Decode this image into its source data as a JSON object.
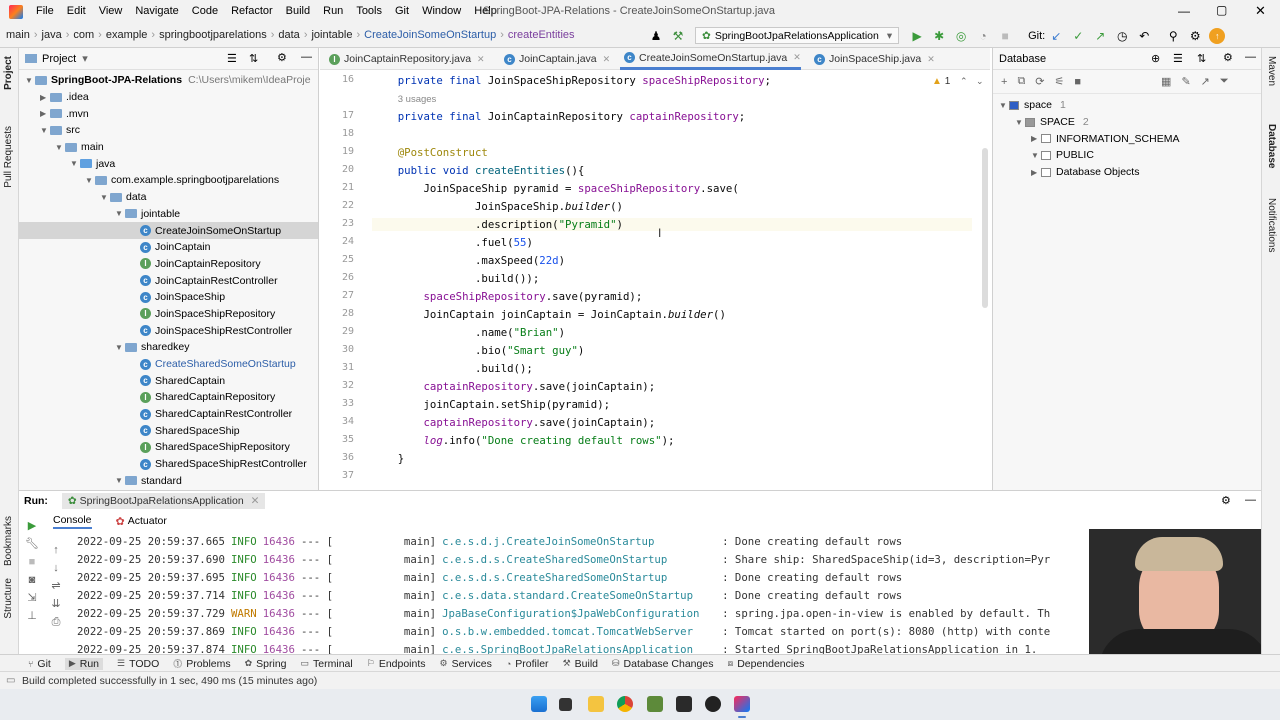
{
  "titlebar": {
    "menus": [
      "File",
      "Edit",
      "View",
      "Navigate",
      "Code",
      "Refactor",
      "Build",
      "Run",
      "Tools",
      "Git",
      "Window",
      "Help"
    ],
    "title": "SpringBoot-JPA-Relations - CreateJoinSomeOnStartup.java"
  },
  "navbar": {
    "crumbs": [
      "main",
      "java",
      "com",
      "example",
      "springbootjparelations",
      "data",
      "jointable",
      "CreateJoinSomeOnStartup",
      "createEntities"
    ],
    "run_config": "SpringBootJpaRelationsApplication",
    "git_label": "Git:"
  },
  "project": {
    "title": "Project",
    "items": [
      {
        "label": "SpringBoot-JPA-Relations",
        "extra": "C:\\Users\\mikem\\IdeaProje",
        "depth": 0,
        "icon": "folder",
        "arrow": "down"
      },
      {
        "label": ".idea",
        "depth": 1,
        "icon": "folder",
        "arrow": "right"
      },
      {
        "label": ".mvn",
        "depth": 1,
        "icon": "folder",
        "arrow": "right"
      },
      {
        "label": "src",
        "depth": 1,
        "icon": "folder",
        "arrow": "down"
      },
      {
        "label": "main",
        "depth": 2,
        "icon": "folder",
        "arrow": "down"
      },
      {
        "label": "java",
        "depth": 3,
        "icon": "folder-src",
        "arrow": "down"
      },
      {
        "label": "com.example.springbootjparelations",
        "depth": 4,
        "icon": "folder",
        "arrow": "down"
      },
      {
        "label": "data",
        "depth": 5,
        "icon": "folder",
        "arrow": "down"
      },
      {
        "label": "jointable",
        "depth": 6,
        "icon": "folder",
        "arrow": "down"
      },
      {
        "label": "CreateJoinSomeOnStartup",
        "depth": 7,
        "icon": "class",
        "selected": true
      },
      {
        "label": "JoinCaptain",
        "depth": 7,
        "icon": "class"
      },
      {
        "label": "JoinCaptainRepository",
        "depth": 7,
        "icon": "interface"
      },
      {
        "label": "JoinCaptainRestController",
        "depth": 7,
        "icon": "class"
      },
      {
        "label": "JoinSpaceShip",
        "depth": 7,
        "icon": "class"
      },
      {
        "label": "JoinSpaceShipRepository",
        "depth": 7,
        "icon": "interface"
      },
      {
        "label": "JoinSpaceShipRestController",
        "depth": 7,
        "icon": "class"
      },
      {
        "label": "sharedkey",
        "depth": 6,
        "icon": "folder",
        "arrow": "down"
      },
      {
        "label": "CreateSharedSomeOnStartup",
        "depth": 7,
        "icon": "class"
      },
      {
        "label": "SharedCaptain",
        "depth": 7,
        "icon": "class"
      },
      {
        "label": "SharedCaptainRepository",
        "depth": 7,
        "icon": "interface"
      },
      {
        "label": "SharedCaptainRestController",
        "depth": 7,
        "icon": "class"
      },
      {
        "label": "SharedSpaceShip",
        "depth": 7,
        "icon": "class"
      },
      {
        "label": "SharedSpaceShipRepository",
        "depth": 7,
        "icon": "interface"
      },
      {
        "label": "SharedSpaceShipRestController",
        "depth": 7,
        "icon": "class"
      },
      {
        "label": "standard",
        "depth": 6,
        "icon": "folder",
        "arrow": "down"
      }
    ]
  },
  "editor": {
    "tabs": [
      "JoinCaptainRepository.java",
      "JoinCaptain.java",
      "CreateJoinSomeOnStartup.java",
      "JoinSpaceShip.java"
    ],
    "active_tab": 2,
    "warning_count": "1",
    "lines": [
      {
        "n": "16",
        "html": "    <span class='kw'>private final</span> JoinSpaceShipRepository <span class='fld'>spaceShipRepository</span>;"
      },
      {
        "n": "",
        "html": "    <span class='hint'>3 usages</span>"
      },
      {
        "n": "17",
        "html": "    <span class='kw'>private final</span> JoinCaptainRepository <span class='fld'>captainRepository</span>;"
      },
      {
        "n": "18",
        "html": ""
      },
      {
        "n": "19",
        "html": "    <span class='ann'>@PostConstruct</span>"
      },
      {
        "n": "20",
        "html": "    <span class='kw'>public void</span> <span class='fn'>createEntities</span>(){"
      },
      {
        "n": "21",
        "html": "        JoinSpaceShip pyramid = <span class='fld'>spaceShipRepository</span>.save("
      },
      {
        "n": "22",
        "html": "                JoinSpaceShip.<span class='it'>builder</span>()"
      },
      {
        "n": "23",
        "html": "                .description(<span class='str'>\"Pyramid\"</span>)"
      },
      {
        "n": "24",
        "html": "                .fuel(<span class='num'>55</span>)"
      },
      {
        "n": "25",
        "html": "                .maxSpeed(<span class='num'>22d</span>)"
      },
      {
        "n": "26",
        "html": "                .build());"
      },
      {
        "n": "27",
        "html": "        <span class='fld'>spaceShipRepository</span>.save(pyramid);"
      },
      {
        "n": "28",
        "html": "        JoinCaptain joinCaptain = JoinCaptain.<span class='it'>builder</span>()"
      },
      {
        "n": "29",
        "html": "                .name(<span class='str'>\"Brian\"</span>)"
      },
      {
        "n": "30",
        "html": "                .bio(<span class='str'>\"Smart guy\"</span>)"
      },
      {
        "n": "31",
        "html": "                .build();"
      },
      {
        "n": "32",
        "html": "        <span class='fld'>captainRepository</span>.save(joinCaptain);"
      },
      {
        "n": "33",
        "html": "        joinCaptain.setShip(pyramid);"
      },
      {
        "n": "34",
        "html": "        <span class='fld'>captainRepository</span>.save(joinCaptain);"
      },
      {
        "n": "35",
        "html": "        <span class='fld it'>log</span>.info(<span class='str'>\"Done creating default rows\"</span>);"
      },
      {
        "n": "36",
        "html": "    }"
      },
      {
        "n": "37",
        "html": ""
      }
    ]
  },
  "database": {
    "title": "Database",
    "items": [
      {
        "label": "space",
        "count": "1",
        "depth": 0,
        "arrow": "down"
      },
      {
        "label": "SPACE",
        "count": "2",
        "depth": 1,
        "arrow": "down"
      },
      {
        "label": "INFORMATION_SCHEMA",
        "depth": 2,
        "arrow": "right"
      },
      {
        "label": "PUBLIC",
        "depth": 2,
        "arrow": "down"
      },
      {
        "label": "Database Objects",
        "depth": 2,
        "arrow": "right"
      }
    ]
  },
  "run": {
    "label": "Run:",
    "config": "SpringBootJpaRelationsApplication",
    "tabs": [
      "Console",
      "Actuator"
    ],
    "log": [
      {
        "ts": "2022-09-25 20:59:37.665",
        "lvl": "INFO",
        "pid": "16436",
        "thr": "--- [           main]",
        "cls": "c.e.s.d.j.CreateJoinSomeOnStartup",
        "msg": ": Done creating default rows"
      },
      {
        "ts": "2022-09-25 20:59:37.690",
        "lvl": "INFO",
        "pid": "16436",
        "thr": "--- [           main]",
        "cls": "c.e.s.d.s.CreateSharedSomeOnStartup",
        "msg": ": Share ship: SharedSpaceShip(id=3, description=Pyr"
      },
      {
        "ts": "2022-09-25 20:59:37.695",
        "lvl": "INFO",
        "pid": "16436",
        "thr": "--- [           main]",
        "cls": "c.e.s.d.s.CreateSharedSomeOnStartup",
        "msg": ": Done creating default rows"
      },
      {
        "ts": "2022-09-25 20:59:37.714",
        "lvl": "INFO",
        "pid": "16436",
        "thr": "--- [           main]",
        "cls": "c.e.s.data.standard.CreateSomeOnStartup",
        "msg": ": Done creating default rows"
      },
      {
        "ts": "2022-09-25 20:59:37.729",
        "lvl": "WARN",
        "pid": "16436",
        "thr": "--- [           main]",
        "cls": "JpaBaseConfiguration$JpaWebConfiguration",
        "msg": ": spring.jpa.open-in-view is enabled by default. Th"
      },
      {
        "ts": "2022-09-25 20:59:37.869",
        "lvl": "INFO",
        "pid": "16436",
        "thr": "--- [           main]",
        "cls": "o.s.b.w.embedded.tomcat.TomcatWebServer",
        "msg": ": Tomcat started on port(s): 8080 (http) with conte"
      },
      {
        "ts": "2022-09-25 20:59:37.874",
        "lvl": "INFO",
        "pid": "16436",
        "thr": "--- [           main]",
        "cls": "c.e.s.SpringBootJpaRelationsApplication",
        "msg": ": Started SpringBootJpaRelationsApplication in 1."
      }
    ]
  },
  "bottom_tabs": [
    "Git",
    "Run",
    "TODO",
    "Problems",
    "Spring",
    "Terminal",
    "Endpoints",
    "Services",
    "Profiler",
    "Build",
    "Database Changes",
    "Dependencies"
  ],
  "status": "Build completed successfully in 1 sec, 490 ms (15 minutes ago)",
  "side_labels": {
    "left": [
      "Project",
      "Pull Requests",
      "Bookmarks",
      "Structure"
    ],
    "right": [
      "Maven",
      "Database",
      "Notifications"
    ]
  }
}
